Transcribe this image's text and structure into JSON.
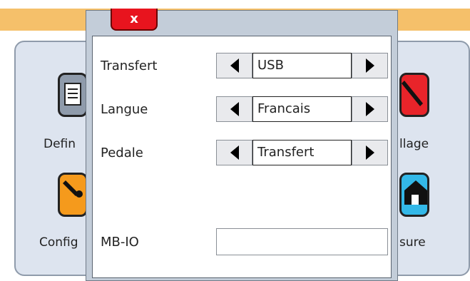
{
  "background": {
    "tiles": {
      "left_top_label": "Defin",
      "left_bottom_label": "Config",
      "right_top_label": "llage",
      "right_bottom_label": "sure"
    },
    "colors": {
      "banner": "#f5c06a",
      "panel": "#dde4ef",
      "tile_doc": "#8f9bab",
      "tile_wrench": "#f59a1c",
      "tile_red": "#e8242a",
      "tile_blue": "#33b8e8"
    },
    "icons": [
      "document-icon",
      "wrench-icon",
      "tool-icon",
      "home-icon"
    ]
  },
  "dialog": {
    "close_label": "x",
    "rows": [
      {
        "label": "Transfert",
        "value": "USB"
      },
      {
        "label": "Langue",
        "value": "Francais"
      },
      {
        "label": "Pedale",
        "value": "Transfert"
      }
    ],
    "mbio": {
      "label": "MB-IO",
      "value": ""
    },
    "colors": {
      "close": "#e8141e",
      "frame": "#c3cdd9"
    }
  }
}
